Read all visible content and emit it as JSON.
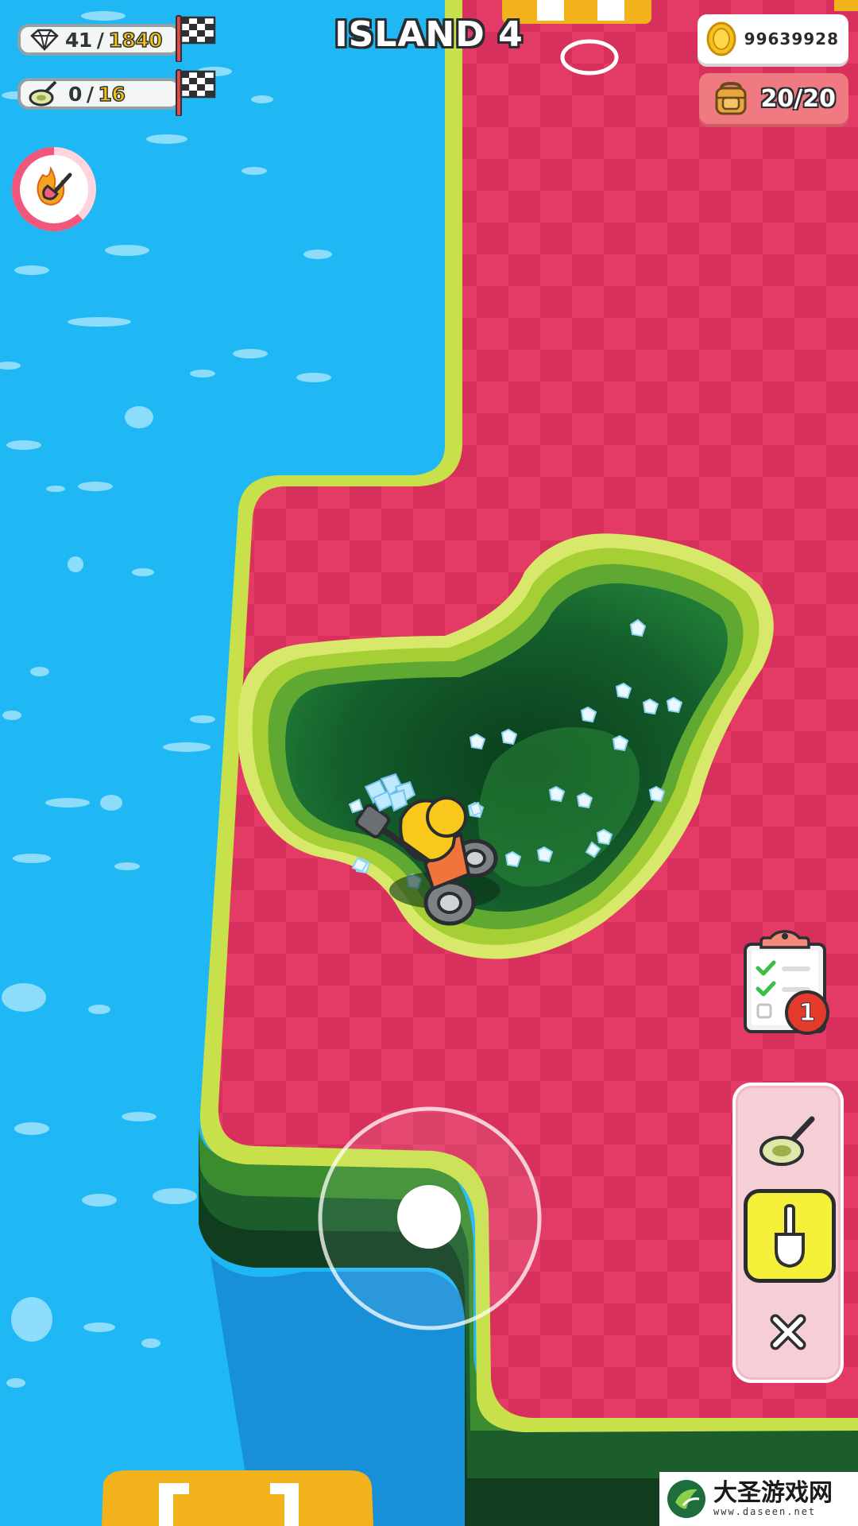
{
  "title": "ISLAND 4",
  "gems": {
    "icon": "diamond-icon",
    "current": "41",
    "separator": "/",
    "target": "1840"
  },
  "detectors": {
    "icon": "metal-detector-icon",
    "current": "0",
    "separator": "/",
    "target": "16"
  },
  "coins": {
    "icon": "coin-icon",
    "value": "99639928"
  },
  "backpack": {
    "icon": "backpack-icon",
    "value": "20/20"
  },
  "boost": {
    "icon": "flaming-shovel-icon",
    "progress": 0.62
  },
  "tasks": {
    "icon": "clipboard-checklist-icon",
    "badge": "1"
  },
  "tools": [
    {
      "name": "metal-detector",
      "icon": "metal-detector-icon",
      "selected": false
    },
    {
      "name": "shovel",
      "icon": "shovel-icon",
      "selected": true
    },
    {
      "name": "close",
      "icon": "close-icon",
      "selected": false
    }
  ],
  "watermark": {
    "text": "大圣游戏网",
    "url": "www.daseen.net"
  },
  "colors": {
    "water": "#1fb8f5",
    "ground": "#e33a66",
    "ground_check": "#d92e5c",
    "grass_edge": "#c8e04a",
    "pit_dark": "#0f5a2a",
    "accent_yellow": "#f5f03a"
  }
}
